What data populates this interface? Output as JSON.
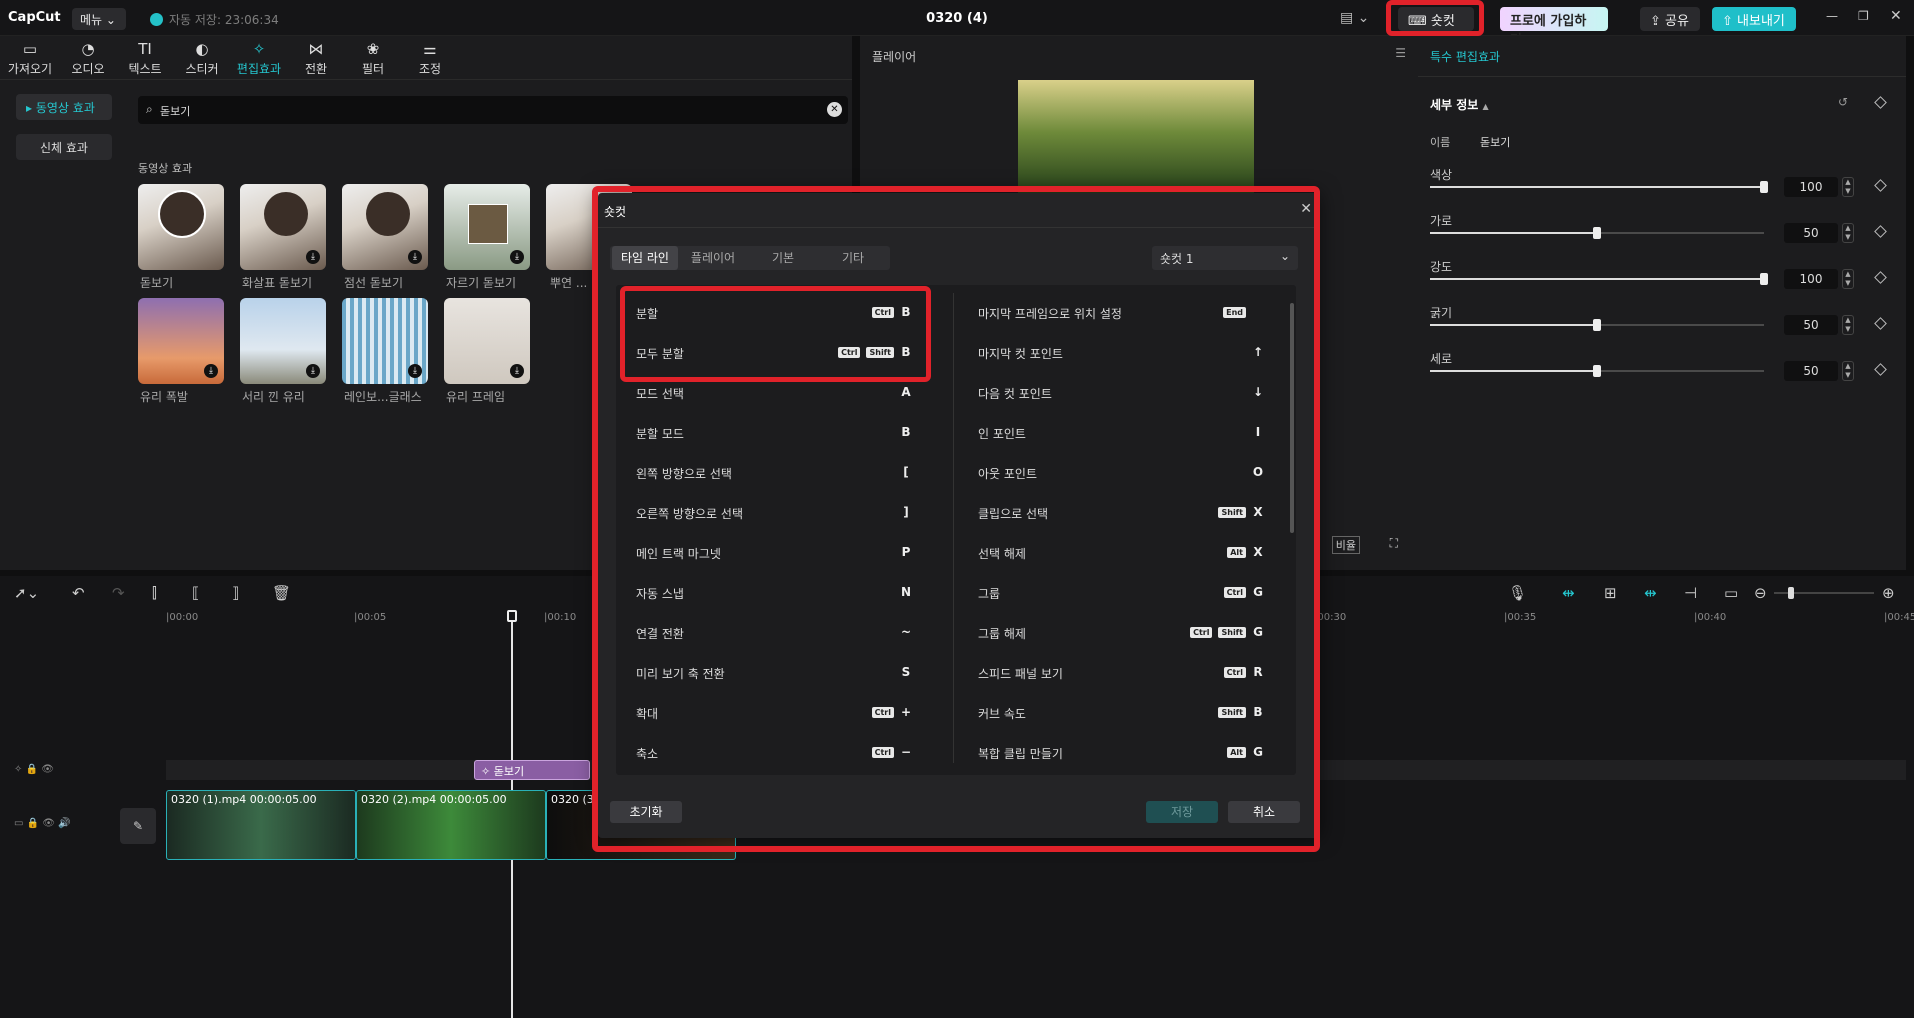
{
  "titlebar": {
    "logo": "CapCut",
    "menu": "메뉴",
    "autosave": "자동 저장: 23:06:34",
    "project_title": "0320 (4)",
    "shortcut_btn": "숏컷",
    "pro_btn": "프로에 가입하기",
    "share_btn": "공유",
    "export_btn": "내보내기"
  },
  "toptabs": [
    {
      "label": "가져오기",
      "icon": "▭"
    },
    {
      "label": "오디오",
      "icon": "◔"
    },
    {
      "label": "텍스트",
      "icon": "TI"
    },
    {
      "label": "스티커",
      "icon": "◐"
    },
    {
      "label": "편집효과",
      "icon": "✧"
    },
    {
      "label": "전환",
      "icon": "⋈"
    },
    {
      "label": "필터",
      "icon": "❀"
    },
    {
      "label": "조정",
      "icon": "⚌"
    }
  ],
  "sidebar": {
    "items": [
      {
        "label": "동영상 효과"
      },
      {
        "label": "신체 효과"
      }
    ]
  },
  "search": {
    "value": "돋보기"
  },
  "effects": {
    "section_title": "동영상 효과",
    "items": [
      {
        "label": "돋보기"
      },
      {
        "label": "화살표 돋보기"
      },
      {
        "label": "점선 돋보기"
      },
      {
        "label": "자르기 돋보기"
      },
      {
        "label": "뿌연 ..."
      },
      {
        "label": "유리 폭발"
      },
      {
        "label": "서리 낀 유리"
      },
      {
        "label": "레인보...글래스"
      },
      {
        "label": "유리 프레임"
      }
    ]
  },
  "player": {
    "title": "플레이어",
    "ratio": "비율"
  },
  "rightpanel": {
    "title": "특수 편집효과",
    "section": "세부 정보",
    "name_label": "이름",
    "name_value": "돋보기",
    "sliders": [
      {
        "label": "색상",
        "value": "100",
        "fraction": 1.0
      },
      {
        "label": "가로",
        "value": "50",
        "fraction": 0.5
      },
      {
        "label": "강도",
        "value": "100",
        "fraction": 1.0
      },
      {
        "label": "굵기",
        "value": "50",
        "fraction": 0.5
      },
      {
        "label": "세로",
        "value": "50",
        "fraction": 0.5
      }
    ]
  },
  "timeline": {
    "ruler": [
      "|00:00",
      "|00:05",
      "|00:10",
      "|00:30",
      "|00:35",
      "|00:40",
      "|00:45"
    ],
    "effect_clip": "돋보기",
    "clips": [
      {
        "label": "0320 (1).mp4  00:00:05.00"
      },
      {
        "label": "0320 (2).mp4  00:00:05.00"
      },
      {
        "label": "0320 (3"
      }
    ]
  },
  "dialog": {
    "title": "숏컷",
    "tabs": [
      "타임 라인",
      "플레이어",
      "기본",
      "기타"
    ],
    "preset": "숏컷 1",
    "left": [
      {
        "label": "분할",
        "mods": [
          "Ctrl"
        ],
        "key": "B"
      },
      {
        "label": "모두 분할",
        "mods": [
          "Ctrl",
          "Shift"
        ],
        "key": "B"
      },
      {
        "label": "모드 선택",
        "mods": [],
        "key": "A"
      },
      {
        "label": "분할 모드",
        "mods": [],
        "key": "B"
      },
      {
        "label": "왼쪽 방향으로 선택",
        "mods": [],
        "key": "["
      },
      {
        "label": "오른쪽 방향으로 선택",
        "mods": [],
        "key": "]"
      },
      {
        "label": "메인 트랙 마그넷",
        "mods": [],
        "key": "P"
      },
      {
        "label": "자동 스냅",
        "mods": [],
        "key": "N"
      },
      {
        "label": "연결 전환",
        "mods": [],
        "key": "~"
      },
      {
        "label": "미리 보기 축 전환",
        "mods": [],
        "key": "S"
      },
      {
        "label": "확대",
        "mods": [
          "Ctrl"
        ],
        "key": "+"
      },
      {
        "label": "축소",
        "mods": [
          "Ctrl"
        ],
        "key": "−"
      }
    ],
    "right": [
      {
        "label": "마지막 프레임으로 위치 설정",
        "mods": [
          "End"
        ],
        "key": ""
      },
      {
        "label": "마지막 컷 포인트",
        "mods": [],
        "key": "↑"
      },
      {
        "label": "다음 컷 포인트",
        "mods": [],
        "key": "↓"
      },
      {
        "label": "인 포인트",
        "mods": [],
        "key": "I"
      },
      {
        "label": "아웃 포인트",
        "mods": [],
        "key": "O"
      },
      {
        "label": "클립으로 선택",
        "mods": [
          "Shift"
        ],
        "key": "X"
      },
      {
        "label": "선택 해제",
        "mods": [
          "Alt"
        ],
        "key": "X"
      },
      {
        "label": "그룹",
        "mods": [
          "Ctrl"
        ],
        "key": "G"
      },
      {
        "label": "그룹 해제",
        "mods": [
          "Ctrl",
          "Shift"
        ],
        "key": "G"
      },
      {
        "label": "스피드 패널 보기",
        "mods": [
          "Ctrl"
        ],
        "key": "R"
      },
      {
        "label": "커브 속도",
        "mods": [
          "Shift"
        ],
        "key": "B"
      },
      {
        "label": "복합 클립 만들기",
        "mods": [
          "Alt"
        ],
        "key": "G"
      }
    ],
    "reset_btn": "초기화",
    "save_btn": "저장",
    "cancel_btn": "취소"
  },
  "colors": {
    "accent": "#25c6cf",
    "highlight": "#e1222a"
  }
}
